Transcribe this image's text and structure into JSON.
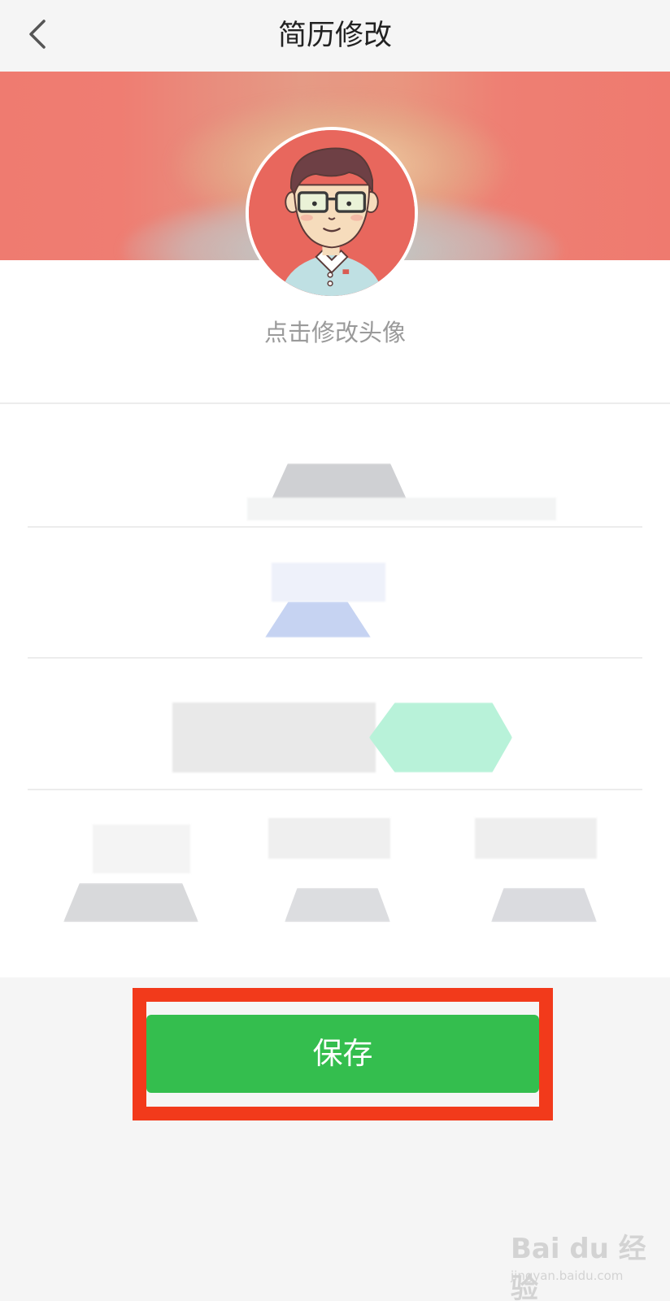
{
  "nav": {
    "title": "简历修改",
    "back_icon": "chevron-left-icon"
  },
  "profile": {
    "avatar_hint": "点击修改头像"
  },
  "actions": {
    "save_label": "保存"
  },
  "watermark": {
    "logo": "Bai du 经验",
    "url": "jingyan.baidu.com"
  },
  "colors": {
    "background": "#f5f5f5",
    "banner": "#ef7a6f",
    "avatar_bg": "#e8675d",
    "save_button": "#34be4e",
    "highlight_border": "#f23a1b"
  }
}
